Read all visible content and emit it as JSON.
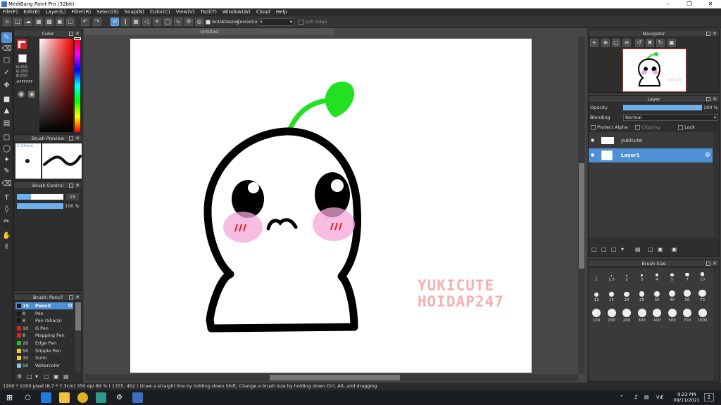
{
  "window": {
    "title": "MediBang Paint Pro (32bit)"
  },
  "menu": [
    "File(F)",
    "Edit(E)",
    "Layer(L)",
    "Filter(R)",
    "Select(S)",
    "Snap(N)",
    "Color(C)",
    "View(V)",
    "Tool(T)",
    "Window(W)",
    "Cloud",
    "Help"
  ],
  "toolbar": {
    "antialias_label": "AntiAliasing",
    "correction_label": "Correction",
    "correction_value": "5",
    "softedge_label": "Soft Edge"
  },
  "color_panel": {
    "title": "Color",
    "r": "R:255",
    "g": "G:255",
    "b": "B:255",
    "hex": "#FFFFFF",
    "fg": "#e02020",
    "bg": "#ffffff"
  },
  "brush_preview": {
    "title": "Brush Preview",
    "size": "1.14mm"
  },
  "brush_control": {
    "title": "Brush Control",
    "size_value": "15",
    "size_pct": 0.3,
    "opacity_value": "100 %",
    "opacity_pct": 1.0
  },
  "brush_panel": {
    "title": "Brush: Pencil",
    "items": [
      {
        "size": "15",
        "name": "Pencil",
        "color": "#1a1a1a",
        "selected": true
      },
      {
        "size": "8",
        "name": "Pen",
        "color": "#1a1a1a"
      },
      {
        "size": "8",
        "name": "Pen (Sharp)",
        "color": "#1a1a1a"
      },
      {
        "size": "10",
        "name": "G Pen",
        "color": "#e02020"
      },
      {
        "size": "8",
        "name": "Mapping Pen",
        "color": "#e02020"
      },
      {
        "size": "20",
        "name": "Edge Pen",
        "color": "#20c020"
      },
      {
        "size": "50",
        "name": "Stipple Pen",
        "color": "#f0d020"
      },
      {
        "size": "30",
        "name": "Sumi",
        "color": "#f0d020"
      },
      {
        "size": "50",
        "name": "Watercolor",
        "color": "#7ec8f0"
      }
    ]
  },
  "document": {
    "tab": "Untitled",
    "watermark_line1": "YUKICUTE",
    "watermark_line2": "HOIDAP247"
  },
  "navigator": {
    "title": "Navigator"
  },
  "layer_panel": {
    "title": "Layer",
    "opacity_label": "Opacity",
    "opacity_value": "100 %",
    "opacity_pct": 1.0,
    "blending_label": "Blending",
    "blending_value": "Normal",
    "protect_alpha": "Protect Alpha",
    "clipping": "Clipping",
    "lock": "Lock",
    "layers": [
      {
        "name": "yukicute",
        "selected": false
      },
      {
        "name": "Layer1",
        "selected": true
      }
    ]
  },
  "brush_size_panel": {
    "title": "Brush Size",
    "sizes": [
      "1",
      "1.5",
      "2",
      "3",
      "4",
      "5",
      "7",
      "10",
      "12",
      "15",
      "20",
      "25",
      "30",
      "40",
      "50",
      "70",
      "100",
      "150",
      "200",
      "300",
      "400",
      "500",
      "700",
      "1000"
    ]
  },
  "status": {
    "dims": "1200 * 1000 pixel",
    "cm": "(8.7 * 7.3cm)",
    "dpi": "350 dpi",
    "zoom": "89 %",
    "coords": "( 1335, 452 )",
    "hint": "Draw a straight line by holding down Shift, Change a brush size by holding down Ctrl, Alt, and dragging"
  },
  "taskbar": {
    "time": "9:23 PM",
    "date": "09/11/2021",
    "lang": "VIE",
    "notif": "2"
  },
  "colors": {
    "accent": "#4e8fd6",
    "sprout": "#22e022",
    "blush": "#f4a6d8",
    "watermark": "#f6b0b0"
  }
}
